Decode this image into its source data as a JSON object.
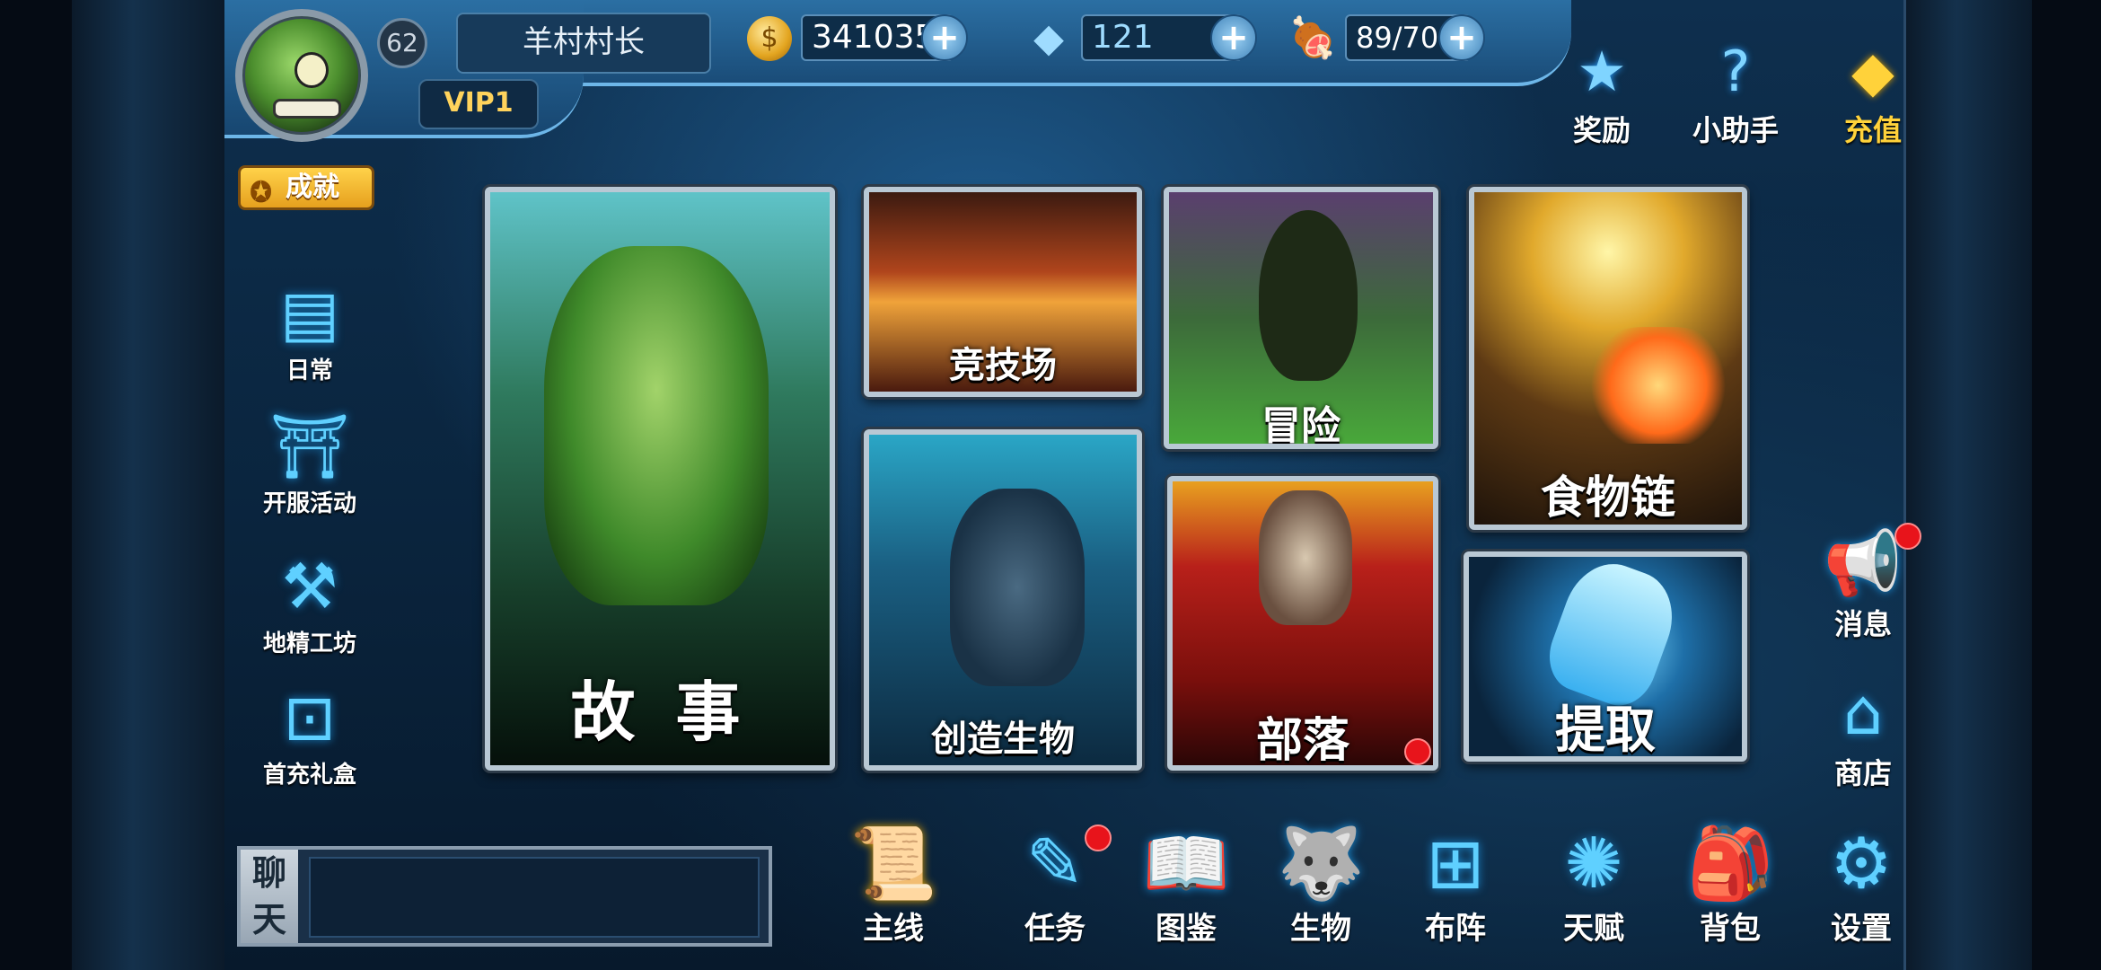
{
  "player": {
    "level": "62",
    "name": "羊村村长",
    "vip": "VIP1",
    "achievement_label": "成就"
  },
  "resources": {
    "gold": "341035",
    "gems": "121",
    "stamina": "89/70"
  },
  "top_actions": [
    {
      "label": "奖励",
      "icon": "star-box-icon"
    },
    {
      "label": "小助手",
      "icon": "help-icon"
    },
    {
      "label": "充值",
      "icon": "diamond-icon"
    }
  ],
  "side_menu": [
    {
      "label": "日常",
      "icon": "scroll-icon"
    },
    {
      "label": "开服活动",
      "icon": "gate-icon"
    },
    {
      "label": "地精工坊",
      "icon": "anvil-icon"
    },
    {
      "label": "首充礼盒",
      "icon": "giftbox-icon"
    }
  ],
  "cards": {
    "story": "故 事",
    "arena": "竞技场",
    "adventure": "冒险",
    "foodchain": "食物链",
    "create": "创造生物",
    "tribe": "部落",
    "extract": "提取"
  },
  "right_menu": [
    {
      "label": "消息",
      "icon": "megaphone-icon"
    },
    {
      "label": "商店",
      "icon": "shop-icon"
    }
  ],
  "chat": {
    "label_line1": "聊",
    "label_line2": "天"
  },
  "bottom_nav": [
    {
      "label": "主线",
      "icon": "map-scroll-icon"
    },
    {
      "label": "任务",
      "icon": "quest-scroll-icon"
    },
    {
      "label": "图鉴",
      "icon": "book-icon"
    },
    {
      "label": "生物",
      "icon": "beast-head-icon"
    },
    {
      "label": "布阵",
      "icon": "formation-icon"
    },
    {
      "label": "天赋",
      "icon": "talent-icon"
    },
    {
      "label": "背包",
      "icon": "backpack-icon"
    },
    {
      "label": "设置",
      "icon": "gear-icon"
    }
  ],
  "colors": {
    "accent": "#5fd0ff",
    "gold": "#ffd23a",
    "notify": "#e8141b"
  }
}
